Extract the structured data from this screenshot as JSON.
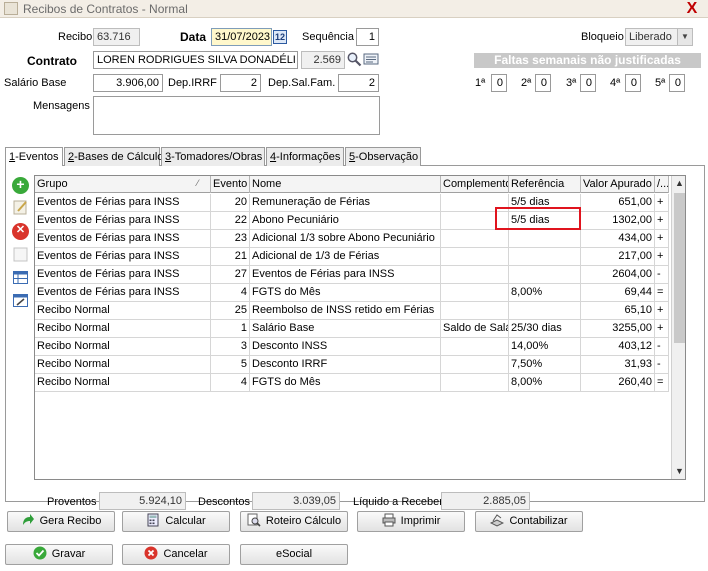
{
  "window": {
    "title": "Recibos de Contratos - Normal",
    "close_glyph": "X"
  },
  "header": {
    "recibo_label": "Recibo",
    "recibo_value": "63.716",
    "data_label": "Data",
    "data_value": "31/07/2023",
    "calendar_glyph": "12",
    "sequencia_label": "Sequência",
    "sequencia_value": "1",
    "bloqueio_label": "Bloqueio",
    "bloqueio_value": "Liberado",
    "contrato_label": "Contrato",
    "contrato_value": "LOREN RODRIGUES SILVA DONADÉLI",
    "contrato_code": "2.569",
    "salario_label": "Salário Base",
    "salario_value": "3.906,00",
    "depirrf_label": "Dep.IRRF",
    "depirrf_value": "2",
    "depsal_label": "Dep.Sal.Fam.",
    "depsal_value": "2",
    "mensagens_label": "Mensagens",
    "mensagens_value": ""
  },
  "faltas": {
    "title": "Faltas semanais não justificadas",
    "weeks": [
      {
        "label": "1ª",
        "value": "0"
      },
      {
        "label": "2ª",
        "value": "0"
      },
      {
        "label": "3ª",
        "value": "0"
      },
      {
        "label": "4ª",
        "value": "0"
      },
      {
        "label": "5ª",
        "value": "0"
      }
    ]
  },
  "tabs": [
    {
      "key": "1",
      "label": "-Eventos"
    },
    {
      "key": "2",
      "label": "-Bases de Cálculo"
    },
    {
      "key": "3",
      "label": "-Tomadores/Obras"
    },
    {
      "key": "4",
      "label": "-Informações"
    },
    {
      "key": "5",
      "label": "-Observação"
    }
  ],
  "grid": {
    "columns": [
      "Grupo",
      "Evento",
      "Nome",
      "Complemento",
      "Referência",
      "Valor Apurado",
      "/..."
    ],
    "rows": [
      {
        "grupo": "Eventos de Férias para INSS",
        "evento": "20",
        "nome": "Remuneração de Férias",
        "complemento": "",
        "referencia": "5/5 dias",
        "valor": "651,00",
        "tipo": "+"
      },
      {
        "grupo": "Eventos de Férias para INSS",
        "evento": "22",
        "nome": "Abono Pecuniário",
        "complemento": "",
        "referencia": "5/5 dias",
        "valor": "1302,00",
        "tipo": "+"
      },
      {
        "grupo": "Eventos de Férias para INSS",
        "evento": "23",
        "nome": "Adicional 1/3 sobre Abono Pecuniário",
        "complemento": "",
        "referencia": "",
        "valor": "434,00",
        "tipo": "+"
      },
      {
        "grupo": "Eventos de Férias para INSS",
        "evento": "21",
        "nome": "Adicional de 1/3 de Férias",
        "complemento": "",
        "referencia": "",
        "valor": "217,00",
        "tipo": "+"
      },
      {
        "grupo": "Eventos de Férias para INSS",
        "evento": "27",
        "nome": "Eventos de Férias para INSS",
        "complemento": "",
        "referencia": "",
        "valor": "2604,00",
        "tipo": "-"
      },
      {
        "grupo": "Eventos de Férias para INSS",
        "evento": "4",
        "nome": "FGTS do Mês",
        "complemento": "",
        "referencia": "8,00%",
        "valor": "69,44",
        "tipo": "="
      },
      {
        "grupo": "Recibo Normal",
        "evento": "25",
        "nome": "Reembolso de INSS retido em Férias",
        "complemento": "",
        "referencia": "",
        "valor": "65,10",
        "tipo": "+"
      },
      {
        "grupo": "Recibo Normal",
        "evento": "1",
        "nome": "Salário Base",
        "complemento": "Saldo de Salár",
        "referencia": "25/30 dias",
        "valor": "3255,00",
        "tipo": "+"
      },
      {
        "grupo": "Recibo Normal",
        "evento": "3",
        "nome": "Desconto INSS",
        "complemento": "",
        "referencia": "14,00%",
        "valor": "403,12",
        "tipo": "-"
      },
      {
        "grupo": "Recibo Normal",
        "evento": "5",
        "nome": "Desconto IRRF",
        "complemento": "",
        "referencia": "7,50%",
        "valor": "31,93",
        "tipo": "-"
      },
      {
        "grupo": "Recibo Normal",
        "evento": "4",
        "nome": "FGTS do Mês",
        "complemento": "",
        "referencia": "8,00%",
        "valor": "260,40",
        "tipo": "="
      }
    ]
  },
  "totals": {
    "proventos_label": "Proventos",
    "proventos_value": "5.924,10",
    "descontos_label": "Descontos",
    "descontos_value": "3.039,05",
    "liquido_label": "Líquido a Receber",
    "liquido_value": "2.885,05"
  },
  "buttons": {
    "gera_recibo": "Gera Recibo",
    "calcular": "Calcular",
    "roteiro": "Roteiro Cálculo",
    "imprimir": "Imprimir",
    "contabilizar": "Contabilizar",
    "gravar": "Gravar",
    "cancelar": "Cancelar",
    "esocial": "eSocial"
  }
}
